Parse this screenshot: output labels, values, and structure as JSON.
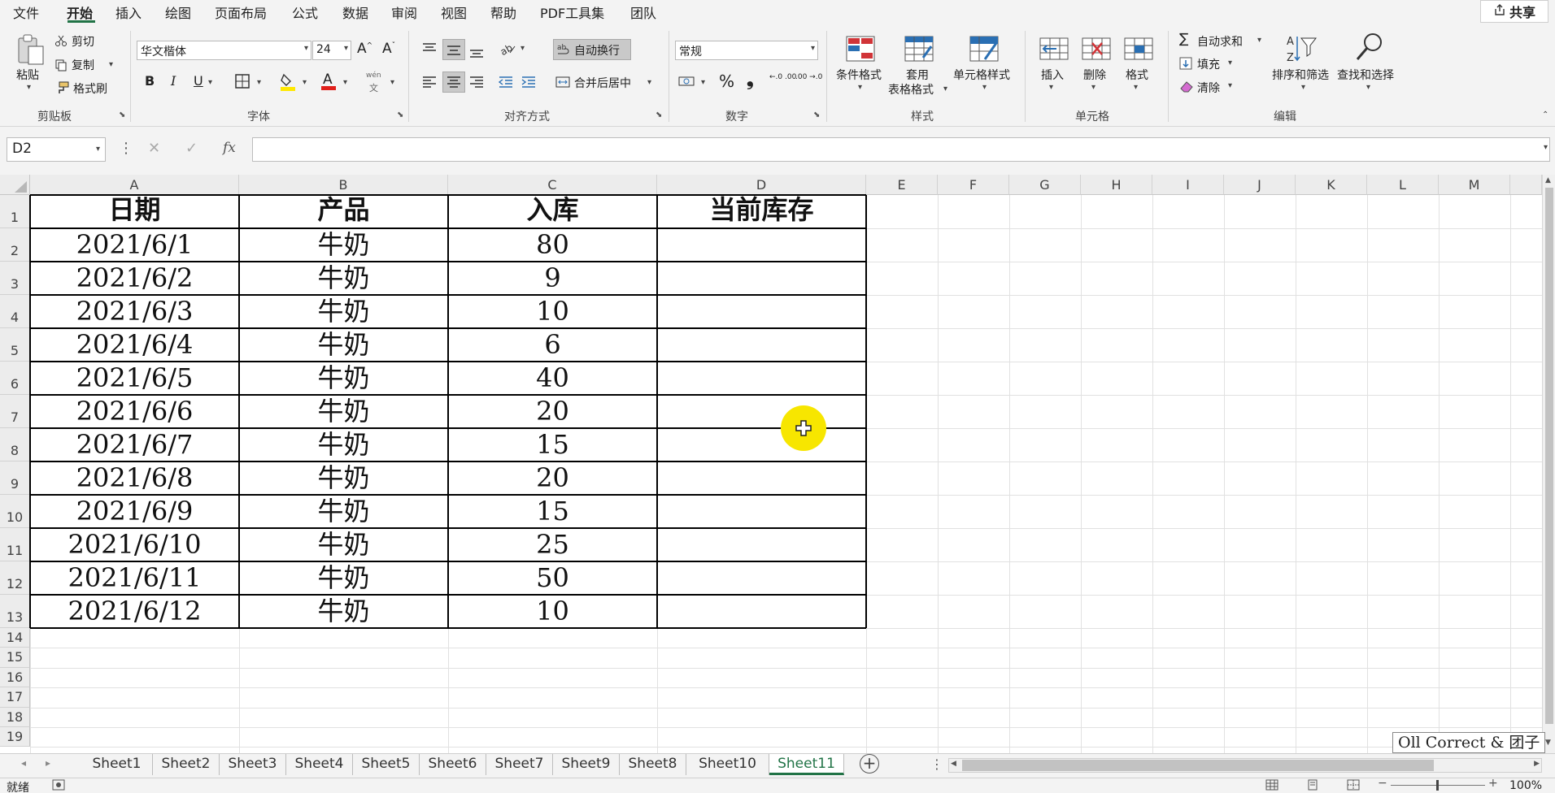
{
  "menu": {
    "items": [
      "文件",
      "开始",
      "插入",
      "绘图",
      "页面布局",
      "公式",
      "数据",
      "审阅",
      "视图",
      "帮助",
      "PDF工具集",
      "团队"
    ],
    "active": "开始",
    "share": "共享"
  },
  "ribbon": {
    "clipboard": {
      "paste": "粘贴",
      "cut": "剪切",
      "copy": "复制",
      "format_painter": "格式刷",
      "label": "剪贴板"
    },
    "font": {
      "name": "华文楷体",
      "size": "24",
      "bold": "B",
      "italic": "I",
      "underline": "U",
      "phonetic": "wén",
      "label": "字体",
      "fill_color": "#ffe800",
      "font_color": "#e0201b"
    },
    "alignment": {
      "wrap": "自动换行",
      "merge": "合并后居中",
      "label": "对齐方式"
    },
    "number": {
      "format": "常规",
      "percent": "%",
      "comma": "❟",
      "inc_decimal": "←.0 .00",
      "dec_decimal": ".00 →.0",
      "label": "数字"
    },
    "styles": {
      "conditional": "条件格式",
      "table_line1": "套用",
      "table_line2": "表格格式",
      "cell_styles": "单元格样式",
      "label": "样式"
    },
    "cells": {
      "insert": "插入",
      "delete": "删除",
      "format": "格式",
      "label": "单元格"
    },
    "editing": {
      "autosum": "自动求和",
      "fill": "填充",
      "clear": "清除",
      "sort": "排序和筛选",
      "find": "查找和选择",
      "label": "编辑"
    }
  },
  "formula_bar": {
    "name_box": "D2",
    "fx": "fx",
    "value": ""
  },
  "sheet": {
    "columns": [
      "A",
      "B",
      "C",
      "D",
      "E",
      "F",
      "G",
      "H",
      "I",
      "J",
      "K",
      "L",
      "M"
    ],
    "rows": [
      "1",
      "2",
      "3",
      "4",
      "5",
      "6",
      "7",
      "8",
      "9",
      "10",
      "11",
      "12",
      "13",
      "14",
      "15",
      "16",
      "17",
      "18",
      "19"
    ],
    "headers": [
      "日期",
      "产品",
      "入库",
      "当前库存"
    ],
    "data": [
      [
        "2021/6/1",
        "牛奶",
        "80",
        ""
      ],
      [
        "2021/6/2",
        "牛奶",
        "9",
        ""
      ],
      [
        "2021/6/3",
        "牛奶",
        "10",
        ""
      ],
      [
        "2021/6/4",
        "牛奶",
        "6",
        ""
      ],
      [
        "2021/6/5",
        "牛奶",
        "40",
        ""
      ],
      [
        "2021/6/6",
        "牛奶",
        "20",
        ""
      ],
      [
        "2021/6/7",
        "牛奶",
        "15",
        ""
      ],
      [
        "2021/6/8",
        "牛奶",
        "20",
        ""
      ],
      [
        "2021/6/9",
        "牛奶",
        "15",
        ""
      ],
      [
        "2021/6/10",
        "牛奶",
        "25",
        ""
      ],
      [
        "2021/6/11",
        "牛奶",
        "50",
        ""
      ],
      [
        "2021/6/12",
        "牛奶",
        "10",
        ""
      ]
    ],
    "selected_cell": "D2"
  },
  "tabs": {
    "sheets": [
      "Sheet1",
      "Sheet2",
      "Sheet3",
      "Sheet4",
      "Sheet5",
      "Sheet6",
      "Sheet7",
      "Sheet9",
      "Sheet8",
      "Sheet10",
      "Sheet11"
    ],
    "active": "Sheet11",
    "add": "+"
  },
  "status": {
    "ready": "就绪",
    "zoom": "100%"
  },
  "watermark": "Oll Correct & 团子",
  "colors": {
    "accent": "#217346",
    "cursor_highlight": "#f7e600"
  }
}
